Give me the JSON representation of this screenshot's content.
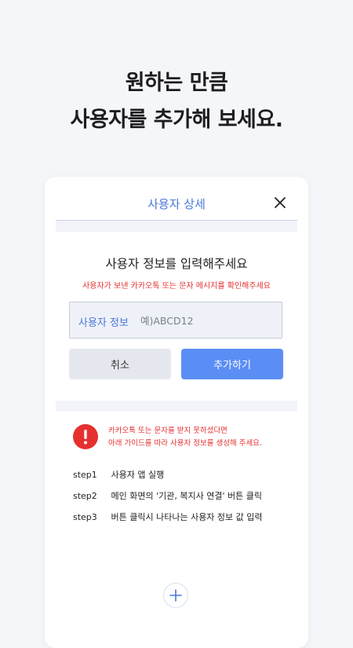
{
  "headline": {
    "line1": "원하는 만큼",
    "line2": "사용자를 추가해 보세요."
  },
  "dialog": {
    "title": "사용자 상세",
    "prompt": "사용자 정보를 입력해주세요",
    "prompt_sub": "사용자가 보낸 카카오톡 또는 문자 메시지를 확인해주세요",
    "input_label": "사용자 정보",
    "input_placeholder": "예)ABCD12",
    "input_value": "",
    "cancel_label": "취소",
    "add_label": "추가하기"
  },
  "guide": {
    "warning_line1": "카카오톡 또는 문자를 받지 못하셨다면",
    "warning_line2": "아래 가이드를 따라 사용자 정보를 생성해 주세요.",
    "steps": [
      {
        "label": "step1",
        "text": "사용자 앱 실행"
      },
      {
        "label": "step2",
        "text": "메인 화면의 '기관, 복지사 연결' 버튼 클릭"
      },
      {
        "label": "step3",
        "text": "버튼 클릭시 나타나는 사용자 정보 값 입력"
      }
    ]
  },
  "icons": {
    "close": "close-icon",
    "warning": "warning-icon",
    "plus": "plus-icon"
  },
  "colors": {
    "accent": "#5b8ef5",
    "title_blue": "#4a78d8",
    "error_red": "#e5302f",
    "background": "#f5f6fa"
  }
}
